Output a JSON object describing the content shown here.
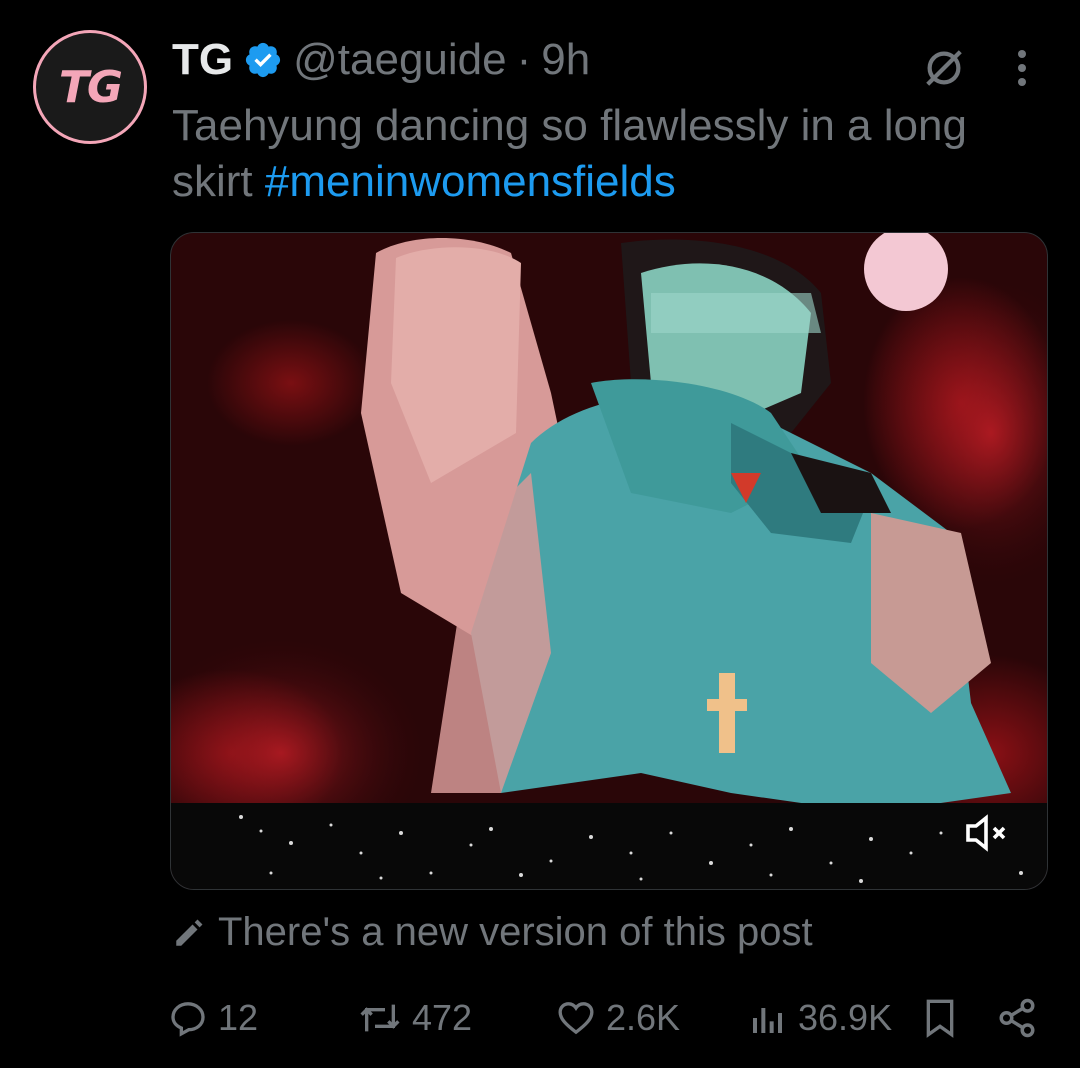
{
  "author": {
    "avatar_text": "TG",
    "name": "TG",
    "handle": "@taeguide",
    "separator": "·",
    "time": "9h",
    "verified": true
  },
  "tweet": {
    "text": "Taehyung dancing so flawlessly in a long skirt ",
    "hashtag": "#meninwomensfields"
  },
  "media": {
    "type": "video",
    "muted": true
  },
  "edited_notice": "There's a new version of this post",
  "actions": {
    "replies": "12",
    "reposts": "472",
    "likes": "2.6K",
    "views": "36.9K"
  },
  "colors": {
    "background": "#000000",
    "text_primary": "#e7e9ea",
    "text_secondary": "#71767b",
    "accent": "#1d9bf0",
    "avatar_ring": "#f4a6b8"
  },
  "icons": [
    "verified-badge-icon",
    "grok-icon",
    "more-icon",
    "mute-icon",
    "edit-icon",
    "reply-icon",
    "repost-icon",
    "like-icon",
    "views-icon",
    "bookmark-icon",
    "share-icon"
  ]
}
